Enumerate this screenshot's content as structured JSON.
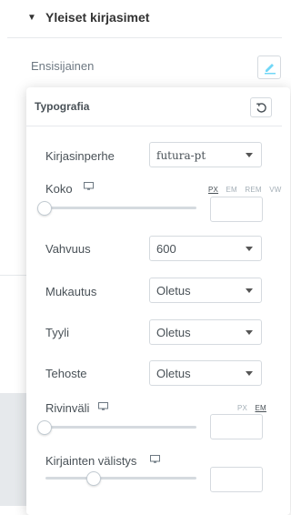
{
  "section": {
    "title": "Yleiset kirjasimet"
  },
  "control": {
    "label": "Ensisijainen"
  },
  "popover": {
    "title": "Typografia",
    "font_family": {
      "label": "Kirjasinperhe",
      "value": "futura-pt"
    },
    "size": {
      "label": "Koko",
      "units": [
        "PX",
        "EM",
        "REM",
        "VW"
      ],
      "active_unit": "PX",
      "value": ""
    },
    "weight": {
      "label": "Vahvuus",
      "value": "600"
    },
    "transform": {
      "label": "Mukautus",
      "value": "Oletus"
    },
    "style": {
      "label": "Tyyli",
      "value": "Oletus"
    },
    "decoration": {
      "label": "Tehoste",
      "value": "Oletus"
    },
    "line_height": {
      "label": "Rivinväli",
      "units": [
        "PX",
        "EM"
      ],
      "active_unit": "EM",
      "value": ""
    },
    "letter_spacing": {
      "label": "Kirjainten välistys",
      "value": ""
    }
  },
  "colors": {
    "accent": "#71d7f7",
    "text": "#495157",
    "border": "#d5dadf",
    "muted": "#a4afb7"
  }
}
